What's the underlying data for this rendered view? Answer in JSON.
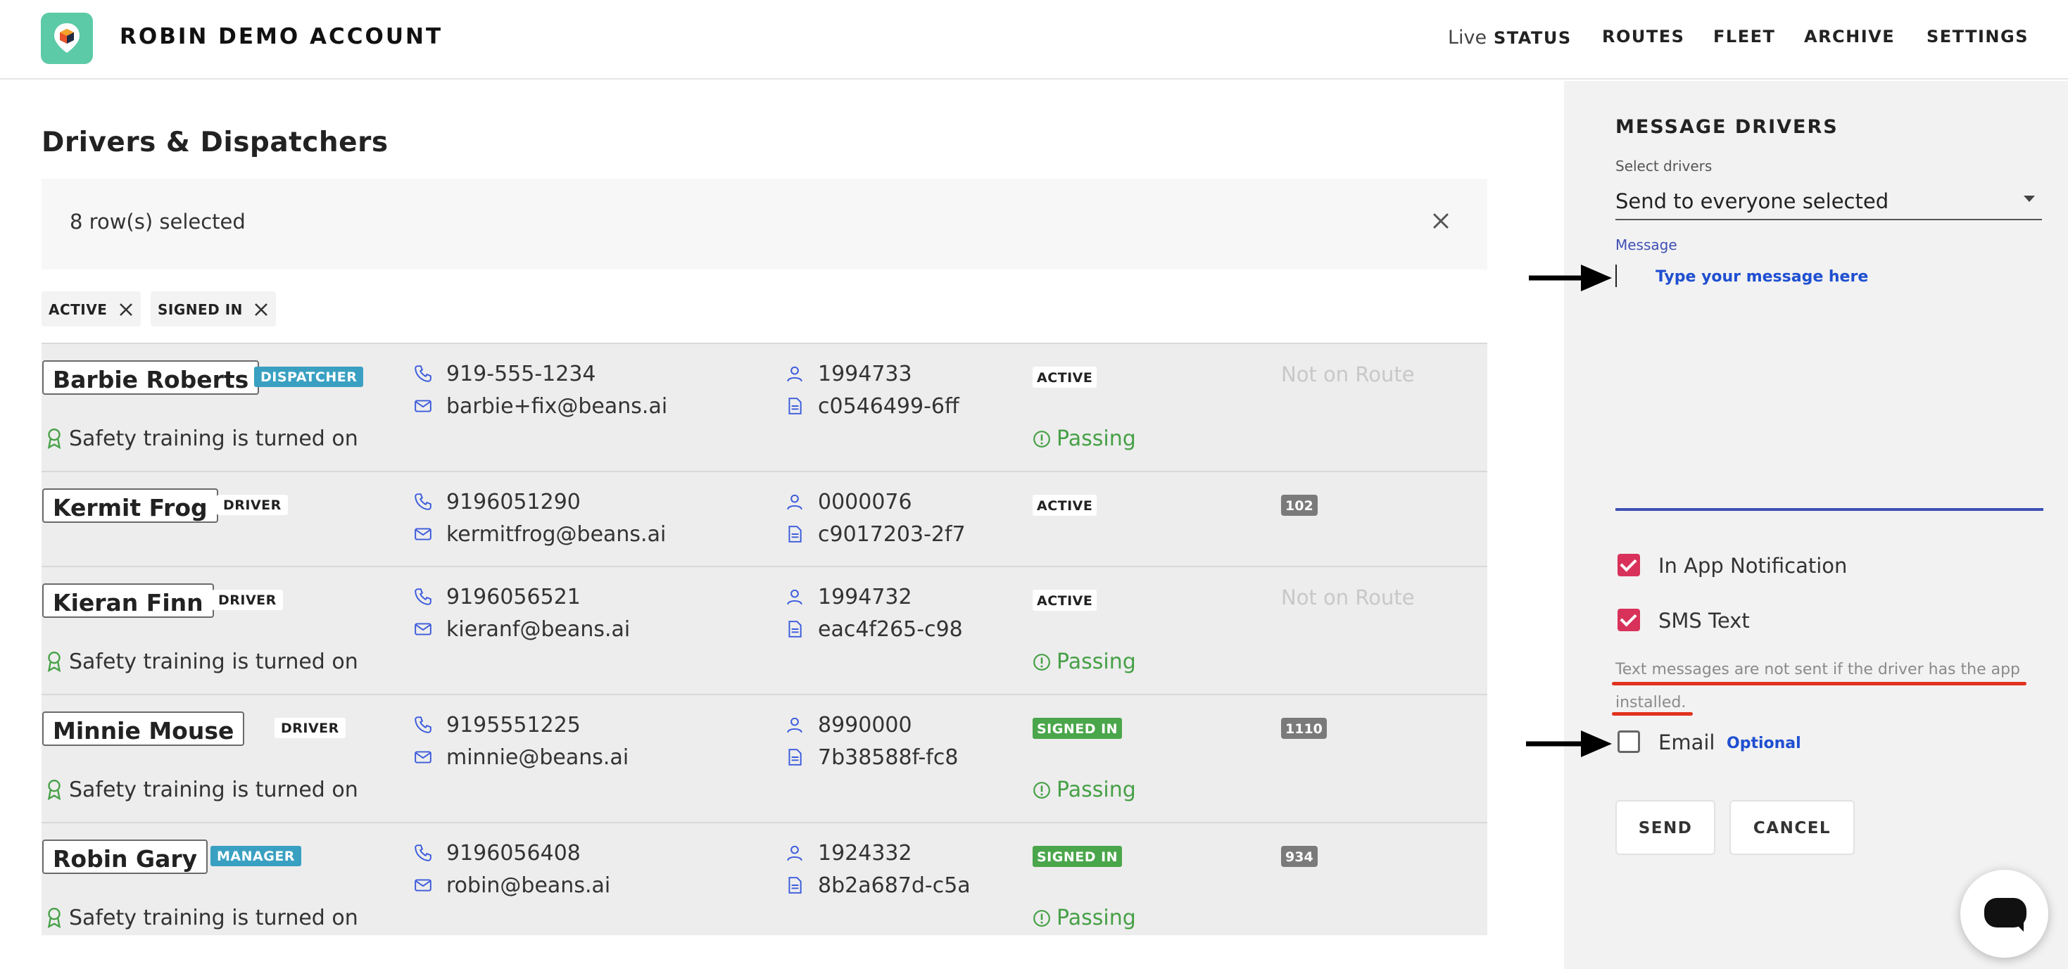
{
  "header": {
    "app_title": "ROBIN DEMO ACCOUNT",
    "nav": {
      "live_prefix": "Live",
      "live_status": "STATUS",
      "routes": "ROUTES",
      "fleet": "FLEET",
      "archive": "ARCHIVE",
      "settings": "SETTINGS"
    }
  },
  "main": {
    "title": "Drivers & Dispatchers",
    "selection_text": "8 row(s) selected",
    "filters": [
      "ACTIVE",
      "SIGNED IN"
    ],
    "rows": [
      {
        "name": "Barbie Roberts",
        "role": "DISPATCHER",
        "phone": "919-555-1234",
        "email": "barbie+fix@beans.ai",
        "employee_id": "1994733",
        "device_id": "c0546499-6ff",
        "status": "ACTIVE",
        "route": "Not on Route",
        "safety": "Safety training is turned on",
        "passing": "Passing"
      },
      {
        "name": "Kermit Frog",
        "role": "DRIVER",
        "phone": "9196051290",
        "email": "kermitfrog@beans.ai",
        "employee_id": "0000076",
        "device_id": "c9017203-2f7",
        "status": "ACTIVE",
        "route": "102"
      },
      {
        "name": "Kieran Finn",
        "role": "DRIVER",
        "phone": "9196056521",
        "email": "kieranf@beans.ai",
        "employee_id": "1994732",
        "device_id": "eac4f265-c98",
        "status": "ACTIVE",
        "route": "Not on Route",
        "safety": "Safety training is turned on",
        "passing": "Passing"
      },
      {
        "name": "Minnie Mouse",
        "role": "DRIVER",
        "phone": "9195551225",
        "email": "minnie@beans.ai",
        "employee_id": "8990000",
        "device_id": "7b38588f-fc8",
        "status": "SIGNED IN",
        "route": "1110",
        "safety": "Safety training is turned on",
        "passing": "Passing"
      },
      {
        "name": "Robin Gary",
        "role": "MANAGER",
        "phone": "9196056408",
        "email": "robin@beans.ai",
        "employee_id": "1924332",
        "device_id": "8b2a687d-c5a",
        "status": "SIGNED IN",
        "route": "934",
        "safety": "Safety training is turned on",
        "passing": "Passing"
      }
    ]
  },
  "panel": {
    "title": "MESSAGE DRIVERS",
    "select_label": "Select drivers",
    "select_value": "Send to everyone selected",
    "message_label": "Message",
    "message_placeholder": "Type your message here",
    "in_app_label": "In App Notification",
    "in_app_checked": true,
    "sms_label": "SMS Text",
    "sms_checked": true,
    "sms_warning": "Text messages are not sent if the driver has the app installed.",
    "email_label": "Email",
    "email_checked": false,
    "email_optional": "Optional",
    "send_label": "SEND",
    "cancel_label": "CANCEL"
  },
  "icons": [
    "app-logo-icon",
    "close-icon",
    "phone-icon",
    "mail-icon",
    "person-icon",
    "document-icon",
    "award-icon",
    "alert-circle-icon",
    "caret-down-icon",
    "arrow-right-icon",
    "chat-icon"
  ],
  "colors": {
    "brand": "#5ccaa6",
    "role_badge": "#3aa0c2",
    "signed_in": "#4aa64a",
    "passing": "#46a046",
    "checkbox": "#d8325a",
    "focus": "#3f51b5",
    "link": "#1f4fd1",
    "annotation_red": "#e0321e"
  }
}
